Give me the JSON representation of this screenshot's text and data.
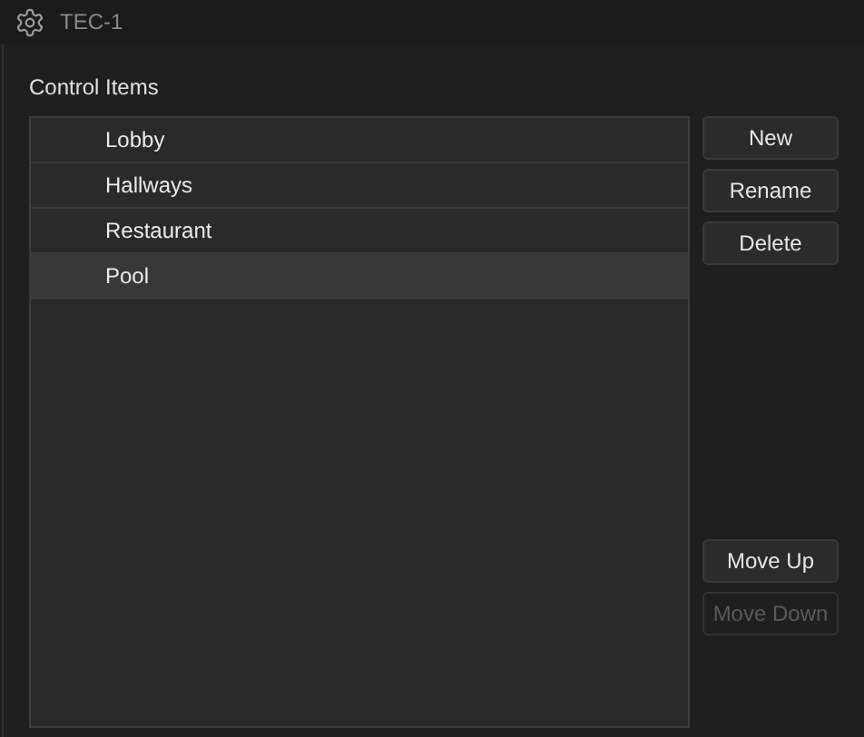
{
  "window": {
    "title": "TEC-1"
  },
  "section_label": "Control Items",
  "items": [
    {
      "label": "Lobby",
      "selected": false
    },
    {
      "label": "Hallways",
      "selected": false
    },
    {
      "label": "Restaurant",
      "selected": false
    },
    {
      "label": "Pool",
      "selected": true
    }
  ],
  "top_buttons": [
    {
      "label": "New",
      "disabled": false
    },
    {
      "label": "Rename",
      "disabled": false
    },
    {
      "label": "Delete",
      "disabled": false
    }
  ],
  "bottom_buttons": [
    {
      "label": "Move Up",
      "disabled": false
    },
    {
      "label": "Move Down",
      "disabled": true
    }
  ]
}
